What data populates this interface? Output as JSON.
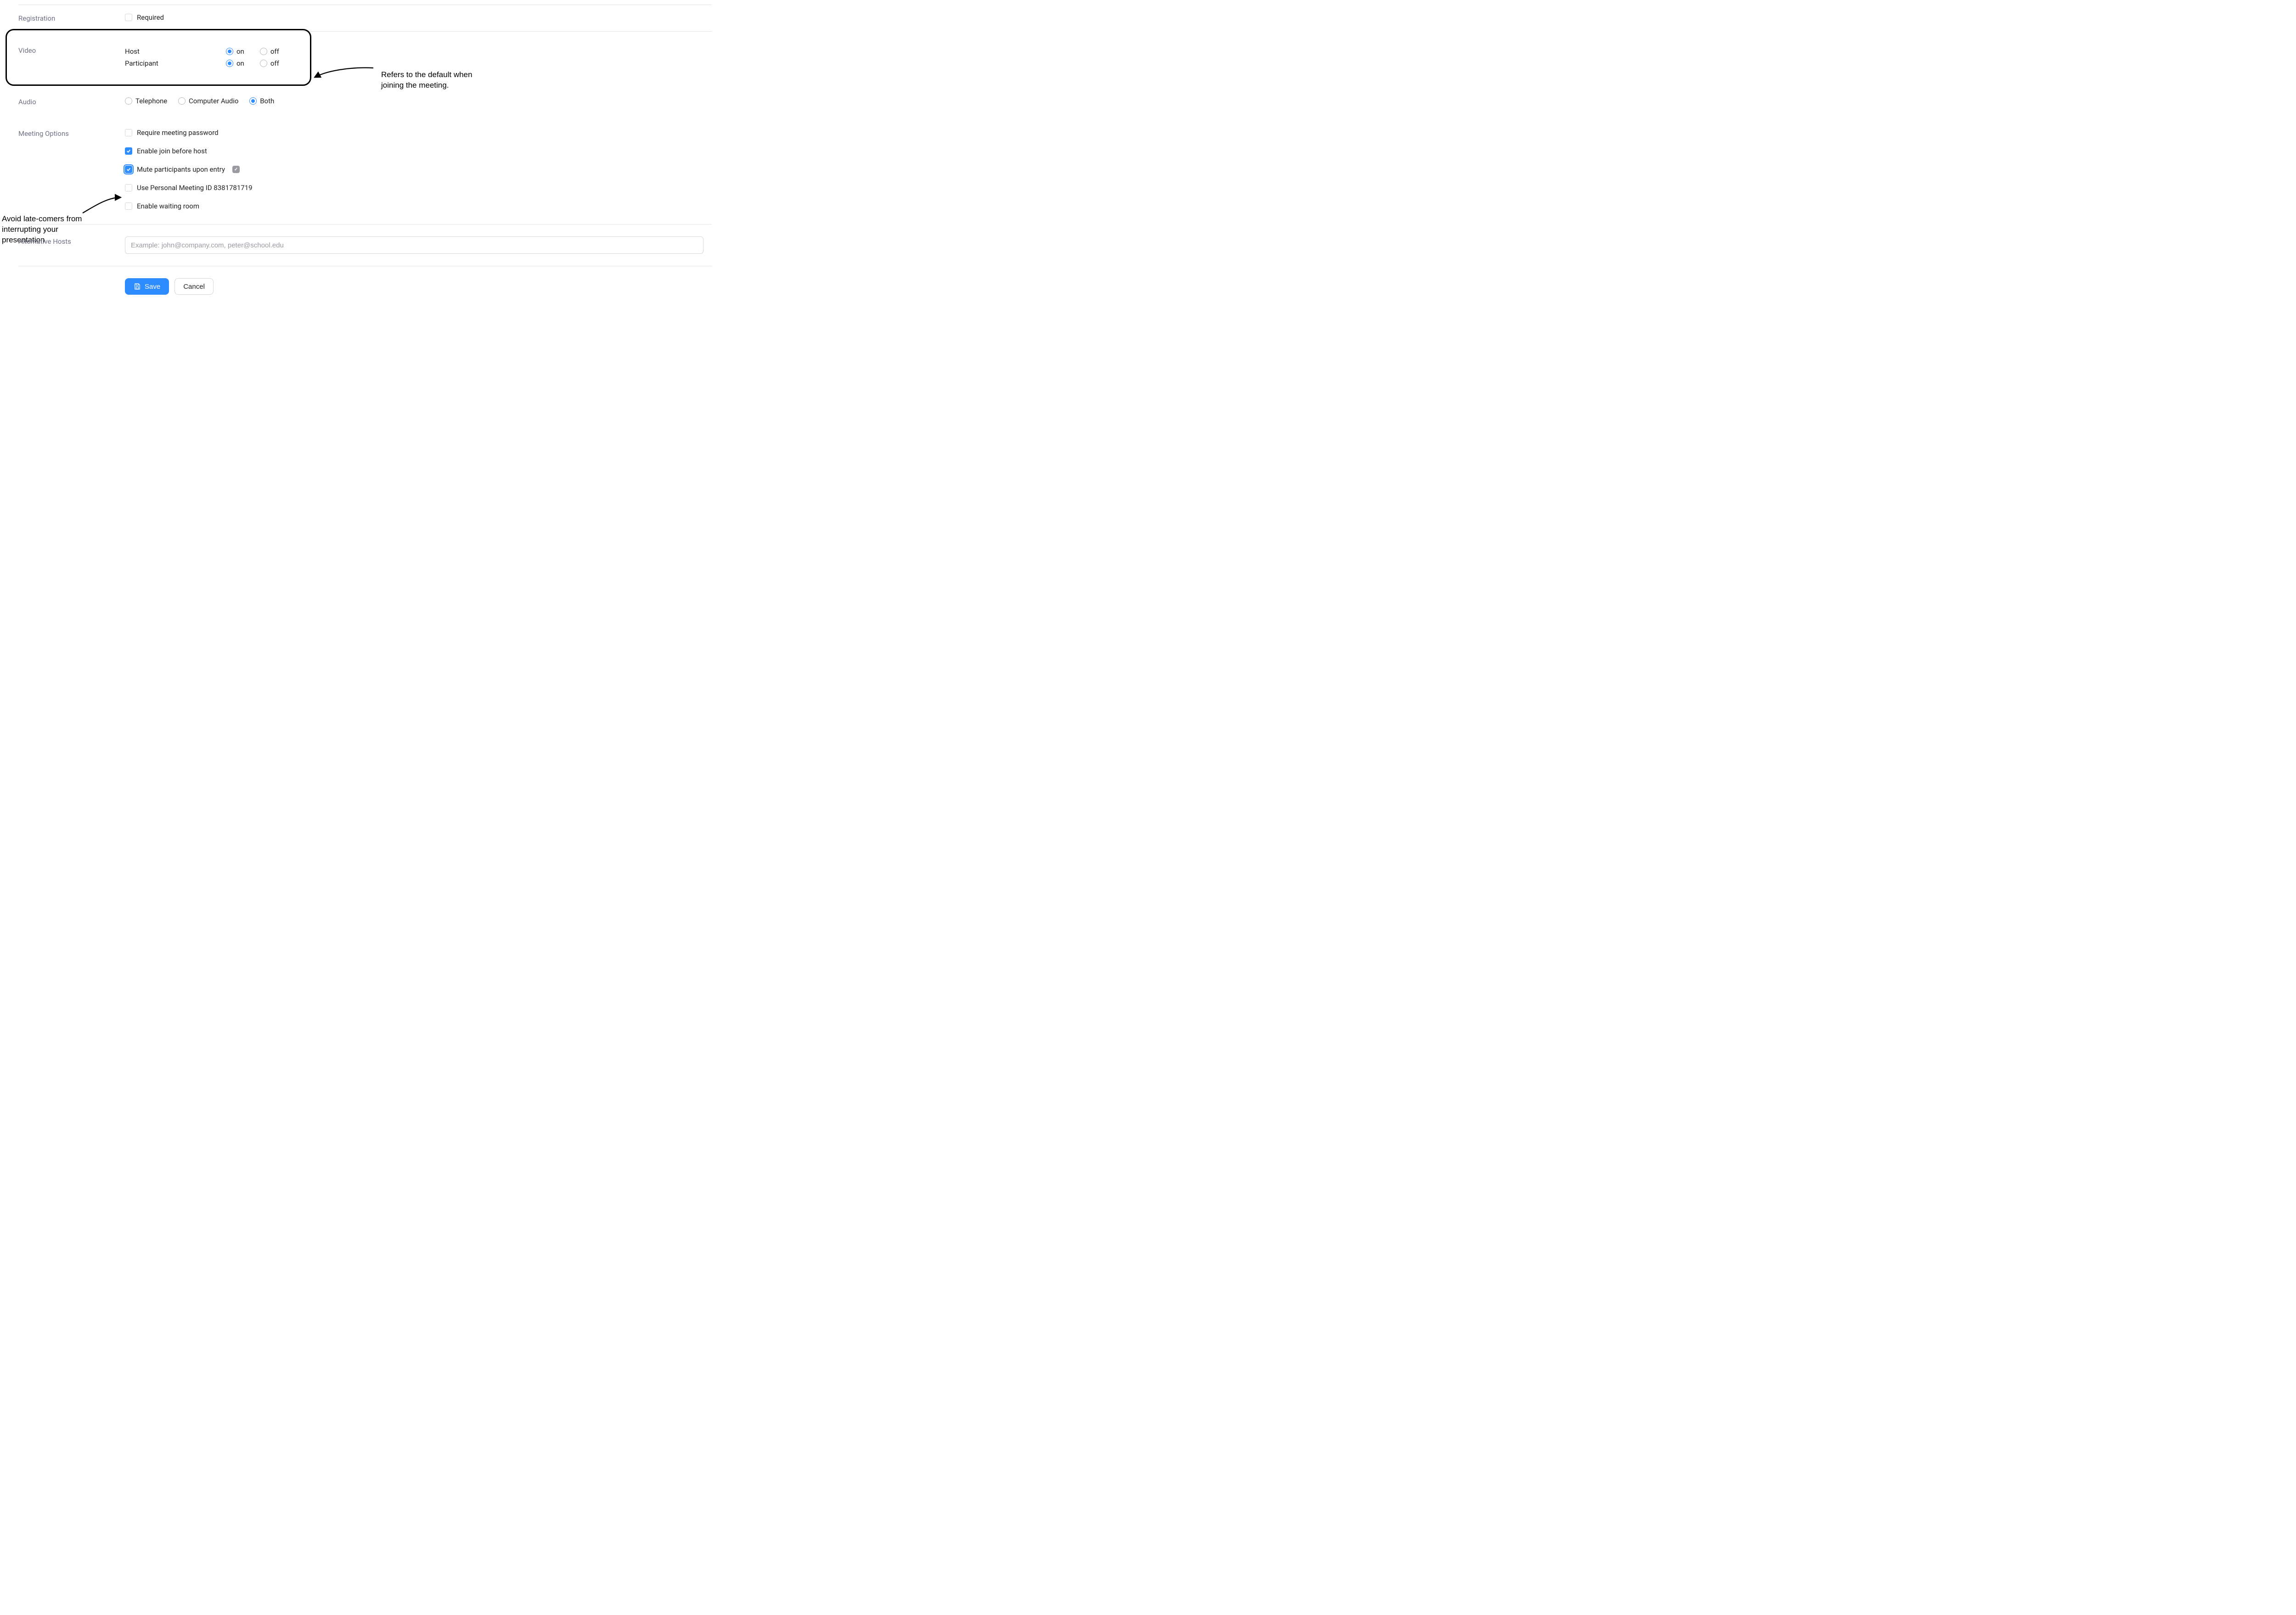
{
  "registration": {
    "label": "Registration",
    "required_label": "Required",
    "required_checked": false
  },
  "video": {
    "label": "Video",
    "host_label": "Host",
    "participant_label": "Participant",
    "on_label": "on",
    "off_label": "off",
    "host_value": "on",
    "participant_value": "on"
  },
  "audio": {
    "label": "Audio",
    "telephone_label": "Telephone",
    "computer_label": "Computer Audio",
    "both_label": "Both",
    "value": "both"
  },
  "meeting_options": {
    "label": "Meeting Options",
    "items": [
      {
        "id": "require_password",
        "label": "Require meeting password",
        "checked": false,
        "highlighted": false,
        "info": false
      },
      {
        "id": "join_before_host",
        "label": "Enable join before host",
        "checked": true,
        "highlighted": false,
        "info": false
      },
      {
        "id": "mute_on_entry",
        "label": "Mute participants upon entry",
        "checked": true,
        "highlighted": true,
        "info": true
      },
      {
        "id": "use_pmi",
        "label": "Use Personal Meeting ID 8381781719",
        "checked": false,
        "highlighted": false,
        "info": false
      },
      {
        "id": "waiting_room",
        "label": "Enable waiting room",
        "checked": false,
        "highlighted": false,
        "info": false
      }
    ]
  },
  "alt_hosts": {
    "label": "Alternative Hosts",
    "placeholder": "Example: john@company.com, peter@school.edu",
    "value": ""
  },
  "buttons": {
    "save_label": "Save",
    "cancel_label": "Cancel"
  },
  "annotations": {
    "video_note": "Refers to the default when joining the meeting.",
    "mute_note": "Avoid late-comers from interrupting your presentation"
  }
}
